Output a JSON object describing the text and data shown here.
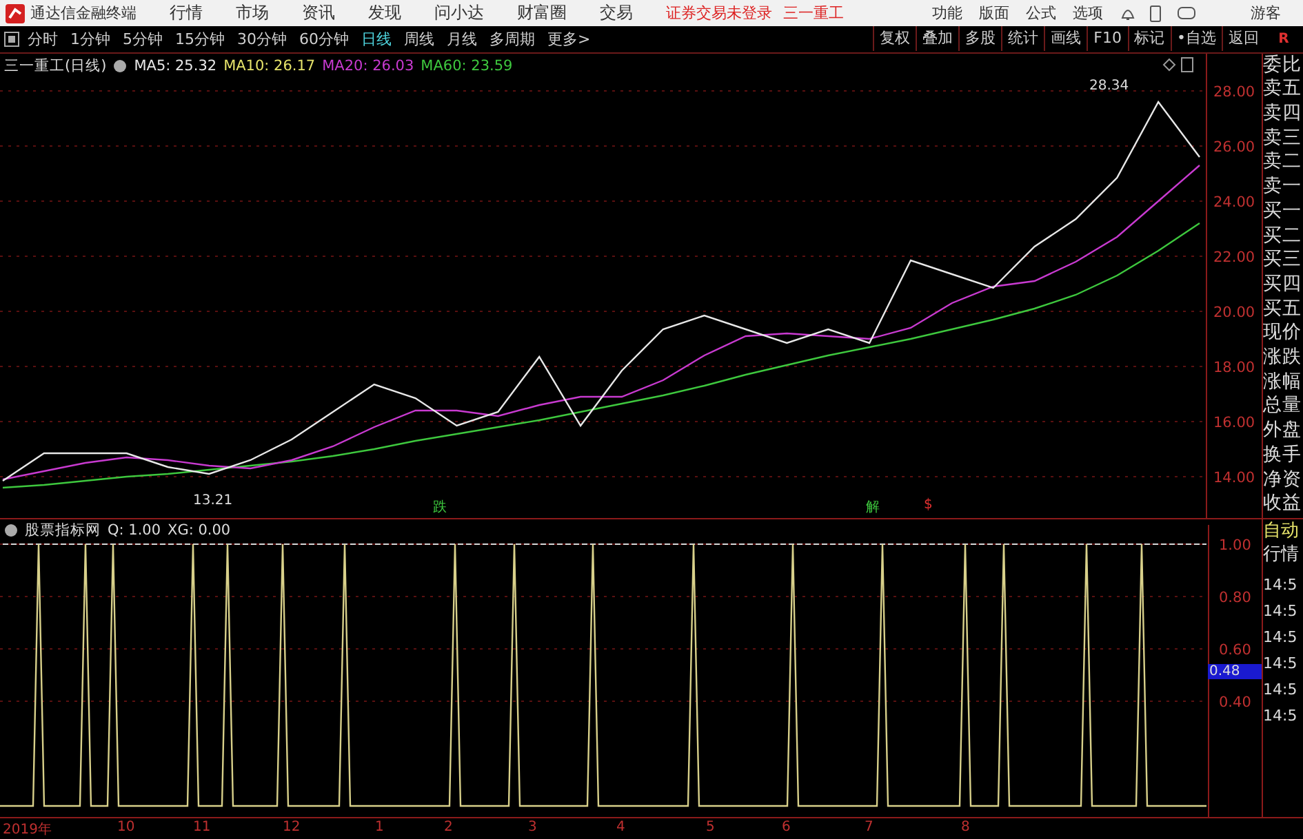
{
  "menu_bar": {
    "app_title": "通达信金融终端",
    "items": [
      "行情",
      "市场",
      "资讯",
      "发现",
      "问小达",
      "财富圈",
      "交易"
    ],
    "login_status": "证券交易未登录",
    "stock_name": "三一重工",
    "tools": [
      "功能",
      "版面",
      "公式",
      "选项"
    ],
    "user": "游客"
  },
  "period_bar": {
    "periods": [
      {
        "label": "分时",
        "selected": false
      },
      {
        "label": "1分钟",
        "selected": false
      },
      {
        "label": "5分钟",
        "selected": false
      },
      {
        "label": "15分钟",
        "selected": false
      },
      {
        "label": "30分钟",
        "selected": false
      },
      {
        "label": "60分钟",
        "selected": false
      },
      {
        "label": "日线",
        "selected": true
      },
      {
        "label": "周线",
        "selected": false
      },
      {
        "label": "月线",
        "selected": false
      },
      {
        "label": "多周期",
        "selected": false
      },
      {
        "label": "更多>",
        "selected": false
      }
    ],
    "actions": [
      "复权",
      "叠加",
      "多股",
      "统计",
      "画线",
      "F10",
      "标记",
      "•自选",
      "返回"
    ],
    "corner": "R"
  },
  "price_panel": {
    "title": "三一重工(日线)",
    "ma_values": [
      {
        "label": "MA5: 25.32",
        "color": "#e8e8e8"
      },
      {
        "label": "MA10: 26.17",
        "color": "#e6e36a"
      },
      {
        "label": "MA20: 26.03",
        "color": "#c83ad0"
      },
      {
        "label": "MA60: 23.59",
        "color": "#3ec83e"
      }
    ],
    "chart_data": {
      "type": "line",
      "grid": true,
      "ylim": [
        12.5,
        29.35
      ],
      "yticks": [
        {
          "value": 28,
          "label": "28.00"
        },
        {
          "value": 26,
          "label": "26.00"
        },
        {
          "value": 24,
          "label": "24.00"
        },
        {
          "value": 22,
          "label": "22.00"
        },
        {
          "value": 20,
          "label": "20.00"
        },
        {
          "value": 18,
          "label": "18.00"
        },
        {
          "value": 16,
          "label": "16.00"
        },
        {
          "value": 14,
          "label": "14.00"
        }
      ],
      "series": [
        {
          "color": "#3ec83e",
          "values": [
            13.6,
            13.7,
            13.85,
            14.0,
            14.1,
            14.25,
            14.4,
            14.55,
            14.75,
            15.0,
            15.3,
            15.55,
            15.8,
            16.05,
            16.35,
            16.65,
            16.95,
            17.3,
            17.7,
            18.05,
            18.4,
            18.7,
            19.0,
            19.35,
            19.7,
            20.1,
            20.6,
            21.3,
            22.2,
            23.2
          ]
        },
        {
          "color": "#c83ad0",
          "values": [
            13.9,
            14.2,
            14.5,
            14.7,
            14.6,
            14.4,
            14.3,
            14.6,
            15.1,
            15.8,
            16.4,
            16.4,
            16.2,
            16.6,
            16.9,
            16.9,
            17.5,
            18.4,
            19.1,
            19.2,
            19.1,
            19.0,
            19.4,
            20.3,
            20.9,
            21.1,
            21.8,
            22.7,
            24.0,
            25.3
          ]
        },
        {
          "color": "#e8e8e8",
          "values": [
            13.85,
            14.85,
            14.85,
            14.85,
            14.35,
            14.1,
            14.6,
            15.35,
            16.35,
            17.35,
            16.85,
            15.85,
            16.35,
            18.35,
            15.85,
            17.85,
            19.35,
            19.85,
            19.35,
            18.85,
            19.35,
            18.85,
            21.85,
            21.35,
            20.85,
            22.35,
            23.35,
            24.85,
            27.6,
            25.6
          ]
        }
      ],
      "annotations": [
        "28.34",
        "13.21"
      ]
    },
    "signals": [
      {
        "text": "跌",
        "color": "#3ec83e"
      },
      {
        "text": "解",
        "color": "#3ec83e"
      },
      {
        "text": "$",
        "color": "#e03030"
      }
    ]
  },
  "quote_labels": [
    "委比",
    "卖五",
    "卖四",
    "卖三",
    "卖二",
    "卖一",
    "买一",
    "买二",
    "买三",
    "买四",
    "买五",
    "现价",
    "涨跌",
    "涨幅",
    "总量",
    "外盘",
    "换手",
    "净资",
    "收益"
  ],
  "indicator_panel": {
    "name": "股票指标网",
    "values": [
      "Q: 1.00",
      "XG: 0.00"
    ],
    "axis": [
      "1.00",
      "0.80",
      "0.60",
      "0.40"
    ],
    "current": "0.48"
  },
  "tick_panel": {
    "title": [
      "自动",
      "行情"
    ],
    "times": [
      "14:5",
      "14:5",
      "14:5",
      "14:5",
      "14:5",
      "14:5"
    ]
  },
  "time_axis": [
    "2019年",
    "10",
    "11",
    "12",
    "1",
    "2",
    "3",
    "4",
    "5",
    "6",
    "7",
    "8"
  ]
}
